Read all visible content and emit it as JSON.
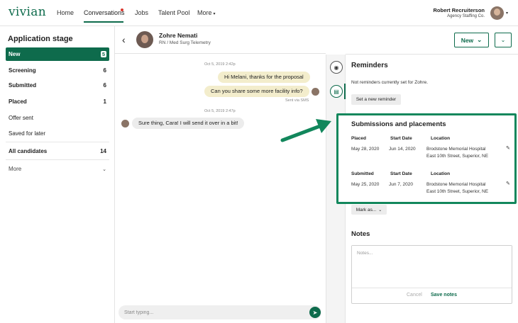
{
  "app": {
    "logo": "vivian"
  },
  "nav": {
    "links": [
      "Home",
      "Conversations",
      "Jobs",
      "Talent Pool",
      "More"
    ],
    "user_name": "Robert Recruiterson",
    "user_org": "Agency Staffing Co."
  },
  "sidebar": {
    "title": "Application stage",
    "items": [
      {
        "label": "New",
        "count": "5"
      },
      {
        "label": "Screening",
        "count": "6"
      },
      {
        "label": "Submitted",
        "count": "6"
      },
      {
        "label": "Placed",
        "count": "1"
      },
      {
        "label": "Offer sent",
        "count": ""
      },
      {
        "label": "Saved for later",
        "count": ""
      },
      {
        "label": "All candidates",
        "count": "14"
      },
      {
        "label": "More",
        "count": ""
      }
    ]
  },
  "conversation": {
    "name": "Zohre Nemati",
    "role": "RN / Med Surg Telemetry",
    "timestamp1": "Oct 5, 2019 2:42p",
    "msg1": "Hi Melani, thanks for the proposal",
    "msg2": "Can you share some more facility info?",
    "via": "Sent via SMS",
    "timestamp2": "Oct 5, 2019 2:47p",
    "msg3": "Sure thing, Cara! I will send it over in a bit!",
    "compose_placeholder": "Start typing..."
  },
  "header": {
    "new_button": "New"
  },
  "reminders": {
    "title": "Reminders",
    "text": "Not reminders currently set for Zohre.",
    "button": "Set a new reminder"
  },
  "submissions": {
    "title": "Submissions and placements",
    "rows": [
      {
        "status": "Placed",
        "start_label": "Start Date",
        "location_label": "Location",
        "date": "May 28, 2020",
        "start": "Jun 14, 2020",
        "location1": "Brodstone Memorial Hospital",
        "location2": "East 10th Street, Superior, NE"
      },
      {
        "status": "Submitted",
        "start_label": "Start Date",
        "location_label": "Location",
        "date": "May 25, 2020",
        "start": "Jun 7, 2020",
        "location1": "Brodstone Memorial Hospital",
        "location2": "East 10th Street, Superior, NE"
      }
    ],
    "mark_button": "Mark as..."
  },
  "notes": {
    "title": "Notes",
    "placeholder": "Notes...",
    "cancel": "Cancel",
    "save": "Save notes"
  },
  "colors": {
    "brand": "#0e6b4c",
    "highlight": "#12875c",
    "bubble_out": "#f3edcc"
  }
}
